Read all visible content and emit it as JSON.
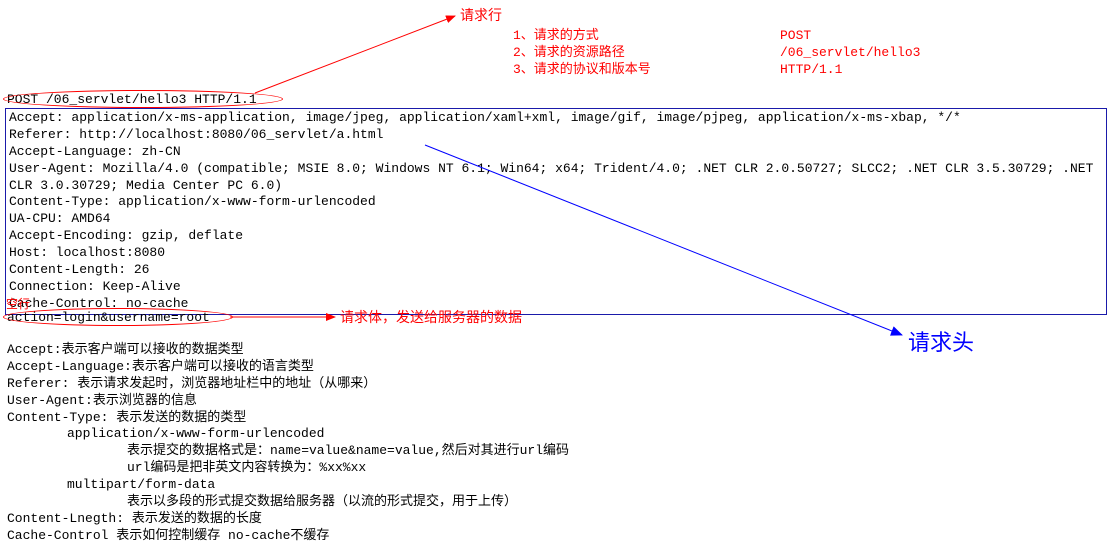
{
  "labels": {
    "request_line_label": "请求行",
    "request_body_label": "请求体，发送给服务器的数据",
    "request_header_label": "请求头",
    "empty_line_label": "空行"
  },
  "request_line_parts": {
    "line1_idx": "1、请求的方式",
    "line2_idx": "2、请求的资源路径",
    "line3_idx": "3、请求的协议和版本号",
    "line1_val": "POST",
    "line2_val": "/06_servlet/hello3",
    "line3_val": "HTTP/1.1"
  },
  "request_line": "POST /06_servlet/hello3 HTTP/1.1",
  "headers": {
    "accept": "Accept: application/x-ms-application, image/jpeg, application/xaml+xml, image/gif, image/pjpeg, application/x-ms-xbap, */*",
    "referer": "Referer: http://localhost:8080/06_servlet/a.html",
    "accept_language": "Accept-Language: zh-CN",
    "user_agent": "User-Agent: Mozilla/4.0 (compatible; MSIE 8.0; Windows NT 6.1; Win64; x64; Trident/4.0; .NET CLR 2.0.50727; SLCC2; .NET CLR 3.5.30729; .NET CLR 3.0.30729; Media Center PC 6.0)",
    "content_type": "Content-Type: application/x-www-form-urlencoded",
    "ua_cpu": "UA-CPU: AMD64",
    "accept_encoding": "Accept-Encoding: gzip, deflate",
    "host": "Host: localhost:8080",
    "content_length": "Content-Length: 26",
    "connection": "Connection: Keep-Alive",
    "cache_control": "Cache-Control: no-cache"
  },
  "body": "action=login&username=root",
  "explanations": {
    "accept": "Accept:表示客户端可以接收的数据类型",
    "accept_language": "Accept-Language:表示客户端可以接收的语言类型",
    "referer": "Referer: 表示请求发起时，浏览器地址栏中的地址（从哪来）",
    "user_agent": "User-Agent:表示浏览器的信息",
    "content_type": "Content-Type: 表示发送的数据的类型",
    "ct_sub1": "application/x-www-form-urlencoded",
    "ct_sub1_desc1": "表示提交的数据格式是：name=value&name=value,然后对其进行url编码",
    "ct_sub1_desc2": "url编码是把非英文内容转换为：%xx%xx",
    "ct_sub2": "multipart/form-data",
    "ct_sub2_desc": "表示以多段的形式提交数据给服务器（以流的形式提交，用于上传）",
    "content_length": "Content-Lnegth: 表示发送的数据的长度",
    "cache_control": "Cache-Control 表示如何控制缓存 no-cache不缓存"
  }
}
